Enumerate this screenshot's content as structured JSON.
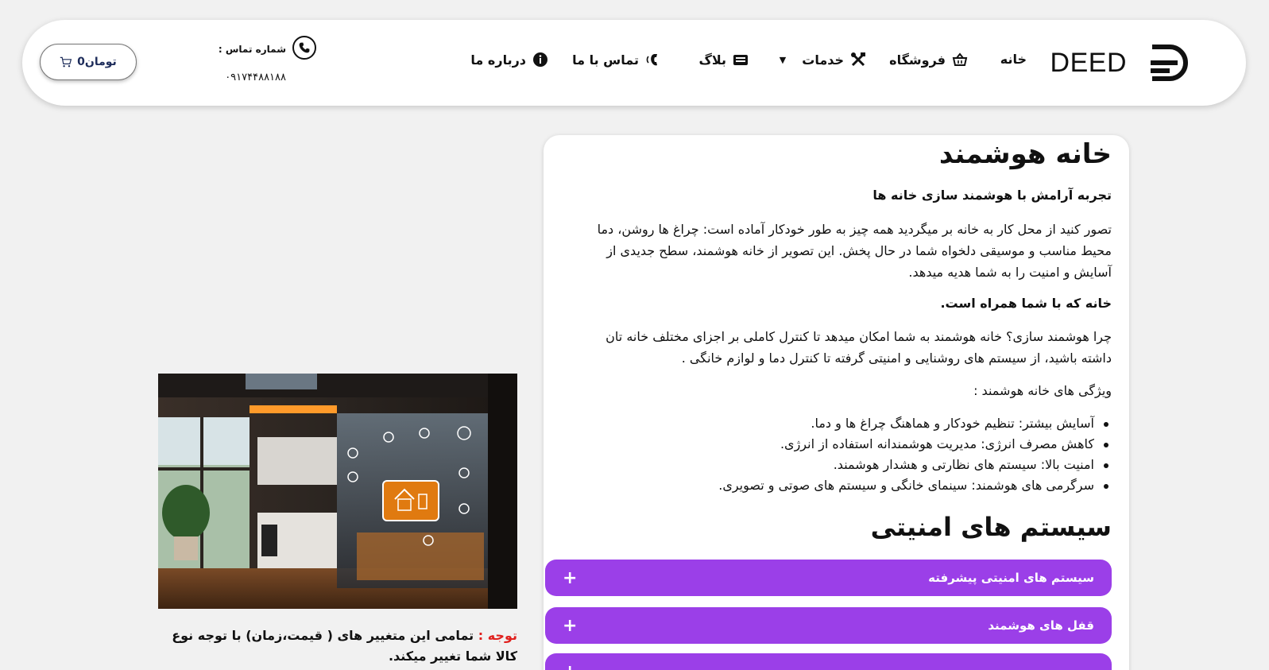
{
  "header": {
    "logo_text": "DEED",
    "nav": [
      {
        "label": "خانه",
        "icon": "none"
      },
      {
        "label": "فروشگاه",
        "icon": "basket-icon"
      },
      {
        "label": "خدمات",
        "icon": "tools-icon"
      },
      {
        "label": "بلاگ",
        "icon": "blog-icon"
      },
      {
        "label": "تماس با ما",
        "icon": "phone-volume-icon"
      },
      {
        "label": "درباره ما",
        "icon": "info-icon"
      }
    ],
    "contact_label": "شماره تماس :",
    "contact_phone": "۰۹۱۷۴۴۸۸۱۸۸",
    "cart_label": "تومان0"
  },
  "main": {
    "title": "خانه هوشمند",
    "subtitle": "تجربه آرامش با هوشمند سازی خانه ها",
    "para1": "تصور کنید از محل کار به خانه بر میگردید همه چیز به طور خودکار آماده است: چراغ ها روشن، دما محیط مناسب و موسیقی دلخواه شما در حال پخش. این تصویر از خانه هوشمند، سطح جدیدی از آسایش و امنیت را به شما هدیه میدهد.",
    "para2": "خانه که با شما همراه است.",
    "para3": "چرا هوشمند سازی؟ خانه هوشمند به شما امکان میدهد تا کنترل کاملی بر اجزای مختلف خانه تان داشته باشید، از سیستم های روشنایی و امنیتی گرفته تا کنترل دما و لوازم خانگی .",
    "para4": "ویژگی های خانه هوشمند :",
    "features": [
      "آسایش بیشتر: تنظیم خودکار و هماهنگ چراغ ها و دما.",
      "کاهش مصرف انرژی: مدیریت هوشمندانه استفاده از انرژی.",
      "امنیت بالا: سیستم های نظارتی و هشدار هوشمند.",
      "سرگرمی های هوشمند: سینمای خانگی و سیستم های صوتی و تصویری."
    ],
    "section_title": "سیستم های امنیتی",
    "accordion": [
      {
        "label": "سیستم های امنیتی پیشرفته",
        "icon": "plus-icon"
      },
      {
        "label": "قفل های هوشمند",
        "icon": "plus-icon"
      },
      {
        "label": "",
        "icon": "plus-icon"
      }
    ]
  },
  "side": {
    "note_label": "توجه :",
    "note_text": "تمامی این متغییر های ( قیمت،زمان) با توجه نوع کالا شما تغییر میکند."
  },
  "colors": {
    "accent": "#9b3fe8",
    "note_red": "#e0201d",
    "background": "#f1f1f1"
  }
}
